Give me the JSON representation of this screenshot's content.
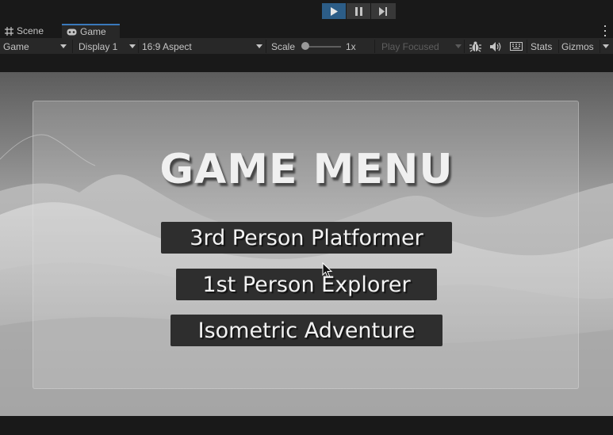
{
  "playbar": {
    "play_icon": "play-icon",
    "pause_icon": "pause-icon",
    "step_icon": "step-icon"
  },
  "tabs": [
    {
      "label": "Scene",
      "icon": "grid-icon"
    },
    {
      "label": "Game",
      "icon": "gamepad-icon"
    }
  ],
  "toolbar": {
    "game_dropdown": "Game",
    "display_dropdown": "Display 1",
    "aspect_dropdown": "16:9 Aspect",
    "scale_label": "Scale",
    "scale_value": "1x",
    "play_focused": "Play Focused",
    "stats": "Stats",
    "gizmos": "Gizmos"
  },
  "menu": {
    "title": "GAME MENU",
    "buttons": [
      "3rd Person Platformer",
      "1st Person Explorer",
      "Isometric Adventure"
    ]
  },
  "colors": {
    "accent": "#3a79bb",
    "play_active": "#2c5d87",
    "button_bg": "#2e2e2e"
  }
}
